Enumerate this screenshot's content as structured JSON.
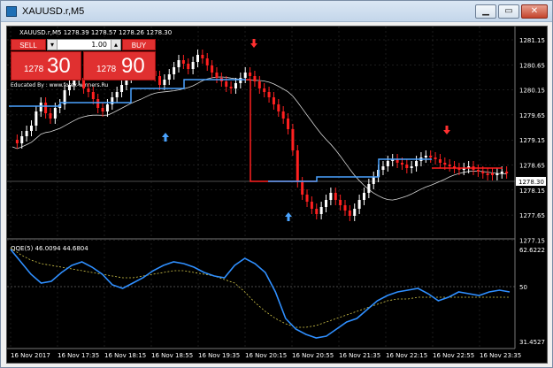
{
  "window": {
    "title": "XAUUSD.r,M5",
    "min": "▁",
    "max": "▭",
    "close": "✕"
  },
  "chart": {
    "symbol_line": "XAUUSD.r,M5  1278.39 1278.57 1278.26 1278.30",
    "watermark": "Educated By : www.forex-winners.Ru",
    "current_price": "1278.30",
    "price_ticks": [
      "1281.15",
      "1280.65",
      "1280.15",
      "1279.65",
      "1279.15",
      "1278.65",
      "1278.15",
      "1277.65",
      "1277.15"
    ],
    "qqe_label": "QQE(5) 46.0094 44.6804",
    "qqe_ticks": [
      "62.6222",
      "50",
      "31.4527"
    ],
    "time_ticks": [
      "16 Nov 2017",
      "16 Nov 17:35",
      "16 Nov 18:15",
      "16 Nov 18:55",
      "16 Nov 19:35",
      "16 Nov 20:15",
      "16 Nov 20:55",
      "16 Nov 21:35",
      "16 Nov 22:15",
      "16 Nov 22:55",
      "16 Nov 23:35"
    ],
    "colors": {
      "bull": "#ffffff",
      "bear": "#ff2020",
      "signal_line": "#4aa3ff",
      "ma": "#d8d8d8",
      "qqe_fast": "#2f8fff",
      "qqe_slow": "#d4c84a",
      "grid": "#3a3a3a",
      "up_arrow": "#4aa3ff",
      "down_arrow": "#ff3030"
    }
  },
  "trade": {
    "sell_label": "SELL",
    "buy_label": "BUY",
    "lot_down": "▾",
    "lot_up": "▴",
    "lot_value": "1.00",
    "sell_small": "1278",
    "sell_big": "30",
    "buy_small": "1278",
    "buy_big": "90"
  }
}
